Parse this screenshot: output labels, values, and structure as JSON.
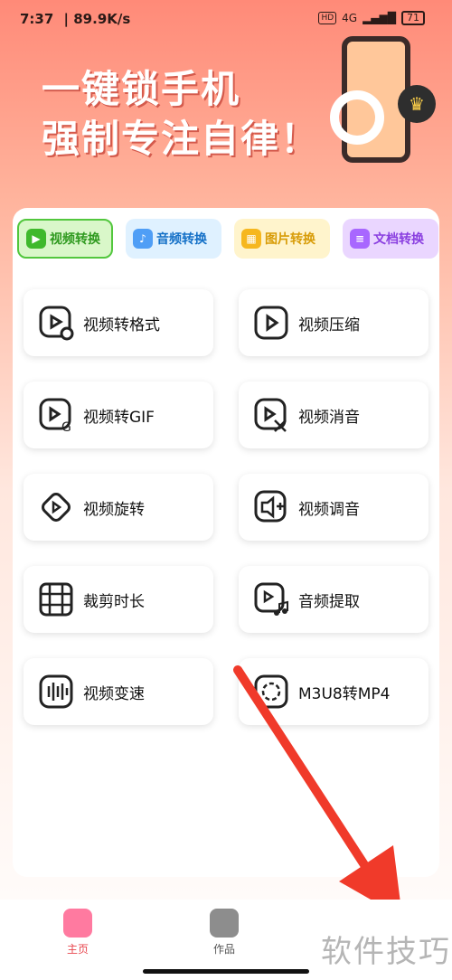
{
  "status_bar": {
    "time": "7:37",
    "speed": "| 89.9K/s",
    "battery": "71",
    "hd": "HD",
    "network": "4G"
  },
  "banner": {
    "line1": "一键锁手机",
    "line2": "强制专注自律！",
    "crown_icon": "♛"
  },
  "tabs": [
    {
      "label": "视频转换",
      "icon": "video-icon"
    },
    {
      "label": "音频转换",
      "icon": "audio-icon"
    },
    {
      "label": "图片转换",
      "icon": "image-icon"
    },
    {
      "label": "文档转换",
      "icon": "document-icon"
    }
  ],
  "tools": [
    {
      "label": "视频转格式",
      "icon": "video-format-icon"
    },
    {
      "label": "视频压缩",
      "icon": "video-compress-icon"
    },
    {
      "label": "视频转GIF",
      "icon": "video-gif-icon"
    },
    {
      "label": "视频消音",
      "icon": "video-mute-icon"
    },
    {
      "label": "视频旋转",
      "icon": "video-rotate-icon"
    },
    {
      "label": "视频调音",
      "icon": "video-volume-icon"
    },
    {
      "label": "裁剪时长",
      "icon": "trim-icon"
    },
    {
      "label": "音频提取",
      "icon": "audio-extract-icon"
    },
    {
      "label": "视频变速",
      "icon": "speed-icon"
    },
    {
      "label": "M3U8转MP4",
      "icon": "m3u8-icon"
    }
  ],
  "bottom_nav": [
    {
      "label": "主页",
      "icon": "home-icon"
    },
    {
      "label": "作品",
      "icon": "works-icon"
    }
  ],
  "watermark": "软件技巧",
  "colors": {
    "accent": "#e8474f",
    "tab_active": "#52c73d"
  }
}
